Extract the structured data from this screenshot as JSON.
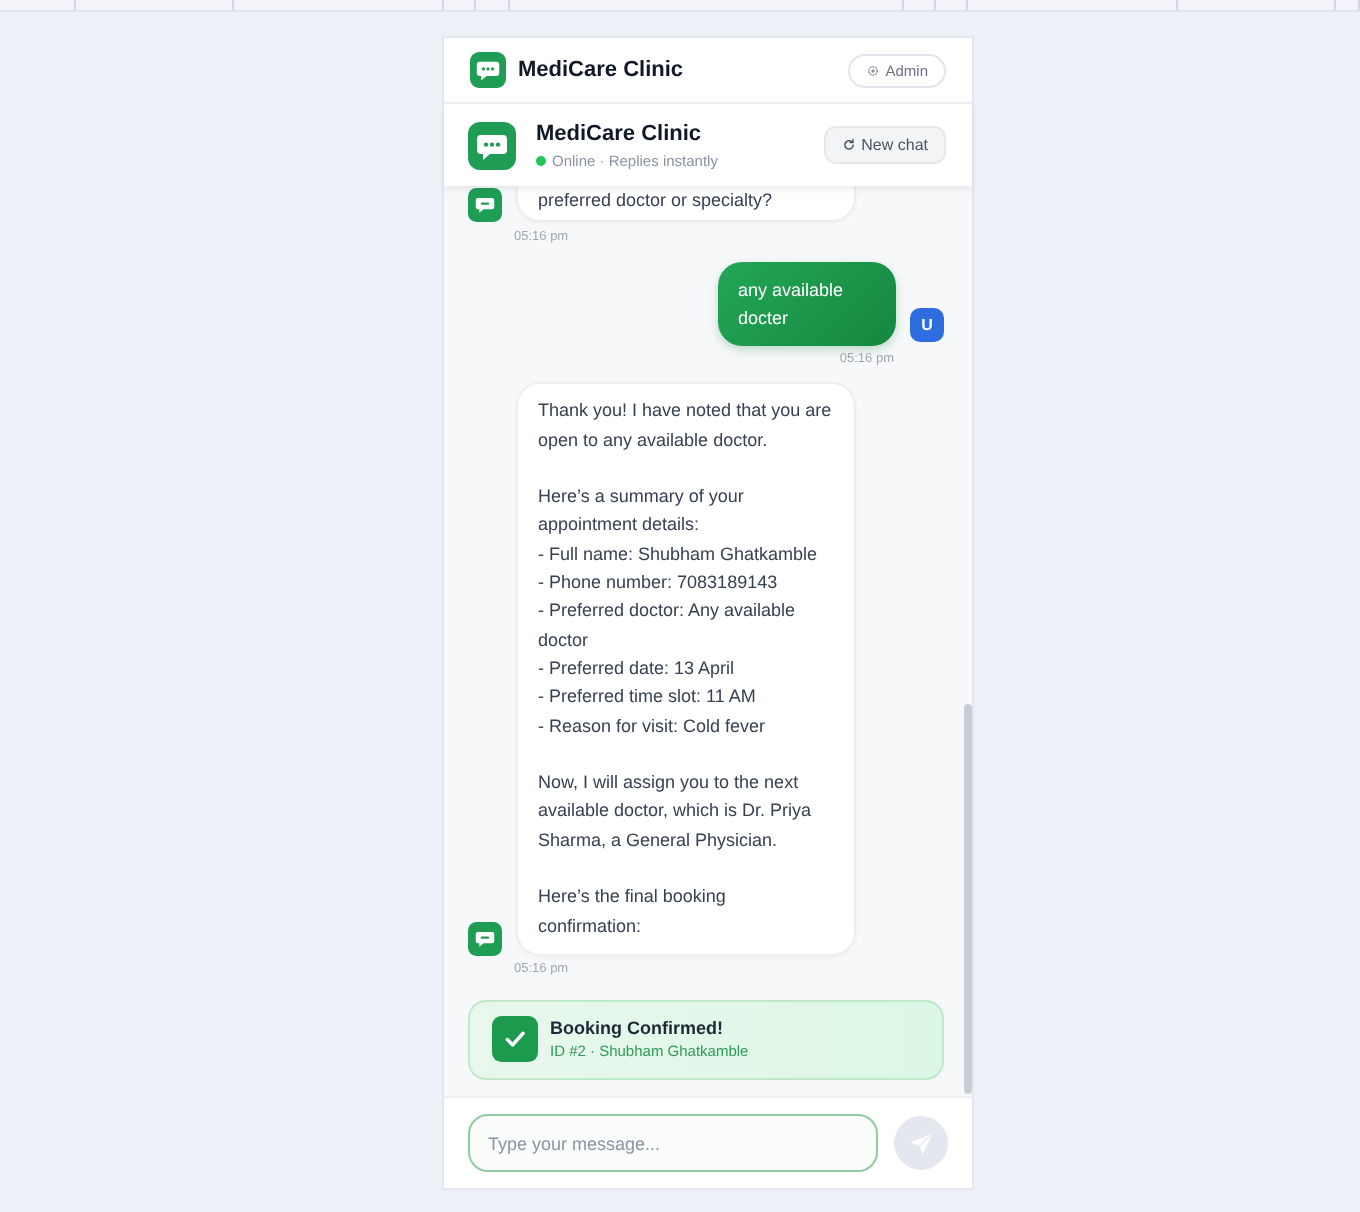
{
  "app_bar": {
    "title": "MediCare Clinic",
    "admin_button": "Admin"
  },
  "chat_header": {
    "title": "MediCare Clinic",
    "online": true,
    "status": "Online · Replies instantly",
    "new_chat_button": "New chat"
  },
  "messages": [
    {
      "kind": "bot",
      "cut_off": true,
      "text": "preferred doctor or specialty?",
      "time": "05:16 pm"
    },
    {
      "kind": "user",
      "cut_off": false,
      "avatar": "U",
      "text": "any available docter",
      "time": "05:16 pm"
    },
    {
      "kind": "bot",
      "cut_off": false,
      "text": "Thank you! I have noted that you are open to any available doctor.\n\nHere’s a summary of your appointment details:\n- Full name: Shubham Ghatkamble\n- Phone number: 7083189143\n- Preferred doctor: Any available doctor\n- Preferred date: 13 April\n- Preferred time slot: 11 AM\n- Reason for visit: Cold fever\n\nNow, I will assign you to the next available doctor, which is Dr. Priya Sharma, a General Physician.\n\nHere’s the final booking confirmation:",
      "time": "05:16 pm"
    }
  ],
  "booking": {
    "title": "Booking Confirmed!",
    "detail": "ID #2 · Shubham Ghatkamble"
  },
  "composer": {
    "placeholder": "Type your message..."
  }
}
